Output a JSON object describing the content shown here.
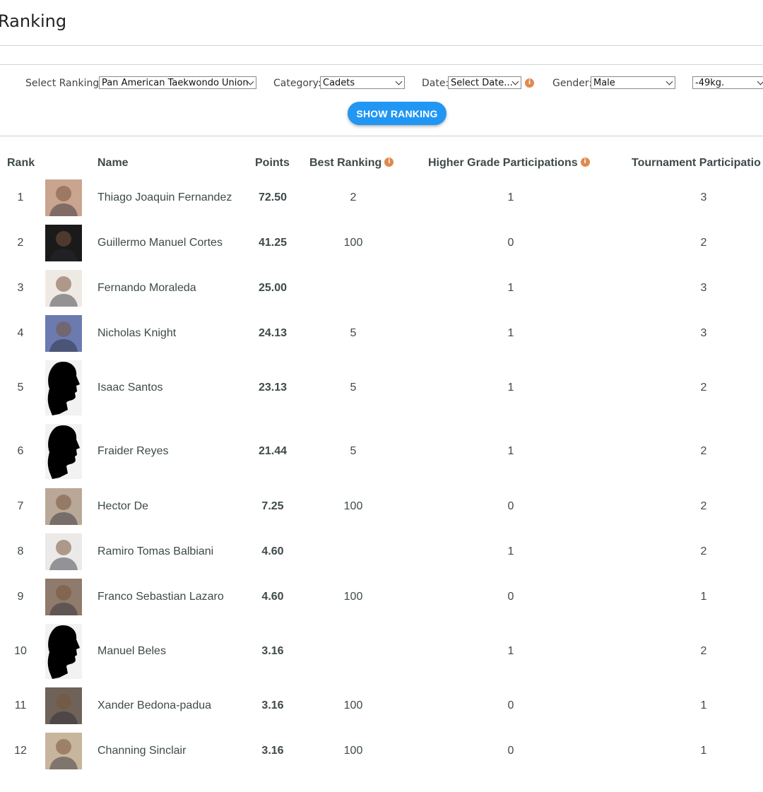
{
  "page": {
    "title": "Ranking"
  },
  "filters": {
    "ranking_label": "Select Ranking:",
    "ranking_value": "Pan American Taekwondo Union",
    "category_label": "Category:",
    "category_value": "Cadets",
    "date_label": "Date:",
    "date_value": "Select Date...",
    "gender_label": "Gender:",
    "gender_value": "Male",
    "weight_value": "-49kg.",
    "show_button": "SHOW RANKING"
  },
  "table": {
    "headers": {
      "rank": "Rank",
      "name": "Name",
      "points": "Points",
      "best": "Best Ranking",
      "higher": "Higher Grade Participations",
      "tournament": "Tournament Participatio"
    },
    "rows": [
      {
        "rank": "1",
        "name": "Thiago Joaquin Fernandez",
        "points": "72.50",
        "best": "2",
        "higher": "1",
        "tournament": "3",
        "photo": "photo"
      },
      {
        "rank": "2",
        "name": "Guillermo Manuel Cortes",
        "points": "41.25",
        "best": "100",
        "higher": "0",
        "tournament": "2",
        "photo": "photo"
      },
      {
        "rank": "3",
        "name": "Fernando Moraleda",
        "points": "25.00",
        "best": "",
        "higher": "1",
        "tournament": "3",
        "photo": "photo"
      },
      {
        "rank": "4",
        "name": "Nicholas Knight",
        "points": "24.13",
        "best": "5",
        "higher": "1",
        "tournament": "3",
        "photo": "photo"
      },
      {
        "rank": "5",
        "name": "Isaac Santos",
        "points": "23.13",
        "best": "5",
        "higher": "1",
        "tournament": "2",
        "photo": "silhouette"
      },
      {
        "rank": "6",
        "name": "Fraider Reyes",
        "points": "21.44",
        "best": "5",
        "higher": "1",
        "tournament": "2",
        "photo": "silhouette"
      },
      {
        "rank": "7",
        "name": "Hector De",
        "points": "7.25",
        "best": "100",
        "higher": "0",
        "tournament": "2",
        "photo": "photo"
      },
      {
        "rank": "8",
        "name": "Ramiro Tomas Balbiani",
        "points": "4.60",
        "best": "",
        "higher": "1",
        "tournament": "2",
        "photo": "photo"
      },
      {
        "rank": "9",
        "name": "Franco Sebastian Lazaro",
        "points": "4.60",
        "best": "100",
        "higher": "0",
        "tournament": "1",
        "photo": "photo"
      },
      {
        "rank": "10",
        "name": "Manuel Beles",
        "points": "3.16",
        "best": "",
        "higher": "1",
        "tournament": "2",
        "photo": "silhouette"
      },
      {
        "rank": "11",
        "name": "Xander Bedona-padua",
        "points": "3.16",
        "best": "100",
        "higher": "0",
        "tournament": "1",
        "photo": "photo"
      },
      {
        "rank": "12",
        "name": "Channing Sinclair",
        "points": "3.16",
        "best": "100",
        "higher": "0",
        "tournament": "1",
        "photo": "photo"
      }
    ]
  },
  "icons": {
    "info": "info-icon",
    "dropdown": "chevron-down-icon",
    "avatar_placeholder": "person-silhouette-icon"
  },
  "colors": {
    "accent": "#2196f3",
    "info_badge": "#e08a4c",
    "text": "#3e4a4a"
  }
}
